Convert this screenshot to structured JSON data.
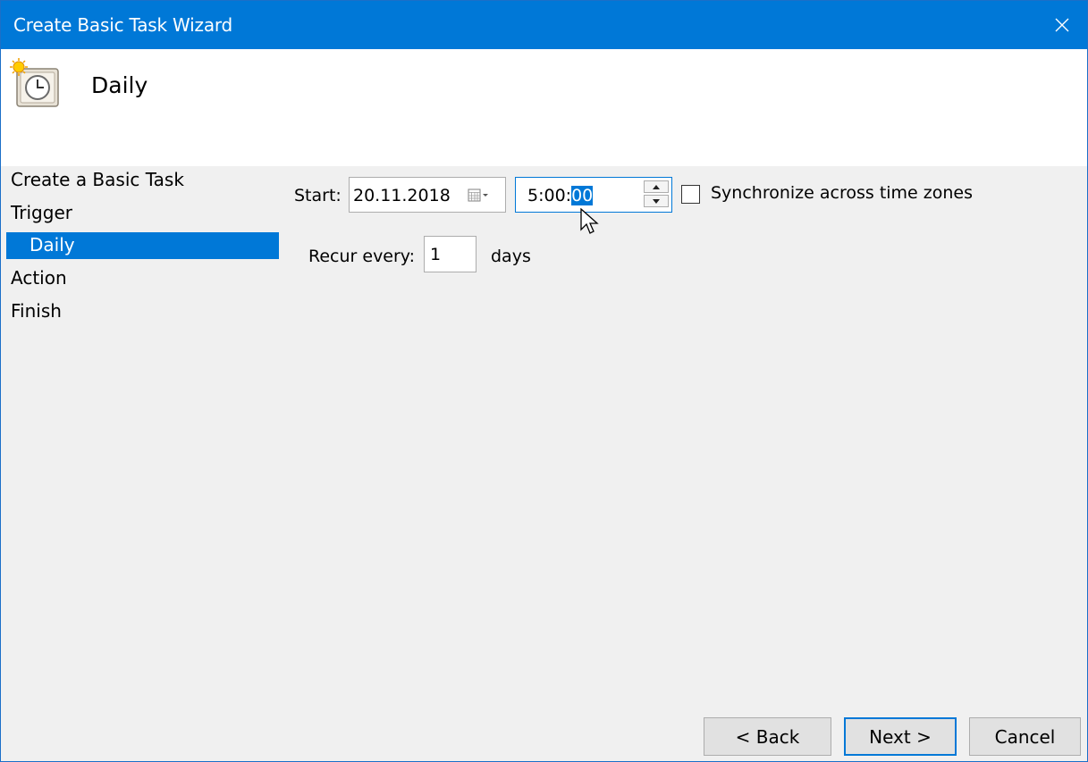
{
  "window": {
    "title": "Create Basic Task Wizard"
  },
  "header": {
    "title": "Daily"
  },
  "steps": {
    "create": "Create a Basic Task",
    "trigger": "Trigger",
    "daily": "Daily",
    "action": "Action",
    "finish": "Finish"
  },
  "form": {
    "start_label": "Start:",
    "start_date": "20.11.2018",
    "start_time_prefix": "5:00:",
    "start_time_selected": "00",
    "sync_label": "Synchronize across time zones",
    "sync_checked": false,
    "recur_label": "Recur every:",
    "recur_value": "1",
    "recur_unit": "days"
  },
  "buttons": {
    "back": "< Back",
    "next": "Next >",
    "cancel": "Cancel"
  },
  "colors": {
    "accent": "#0078d7",
    "panel": "#f0f0f0"
  }
}
